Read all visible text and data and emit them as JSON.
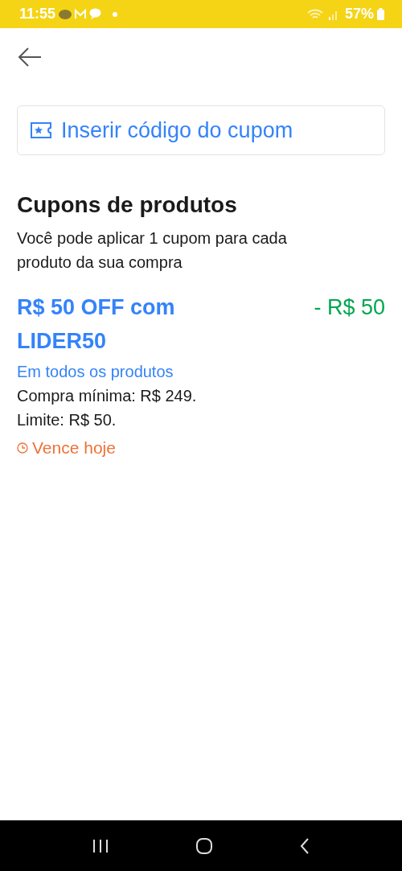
{
  "status_bar": {
    "time": "11:55",
    "battery": "57%"
  },
  "coupon_field": {
    "placeholder": "Inserir código do cupom"
  },
  "section": {
    "title": "Cupons de produtos",
    "description": "Você pode aplicar 1 cupom para cada produto da sua compra"
  },
  "coupons": [
    {
      "title": "R$ 50 OFF com LIDER50",
      "discount": "- R$ 50",
      "scope": "Em todos os produtos",
      "details": [
        "Compra mínima: R$ 249.",
        "Limite: R$ 50."
      ],
      "expiry": "Vence hoje"
    }
  ]
}
